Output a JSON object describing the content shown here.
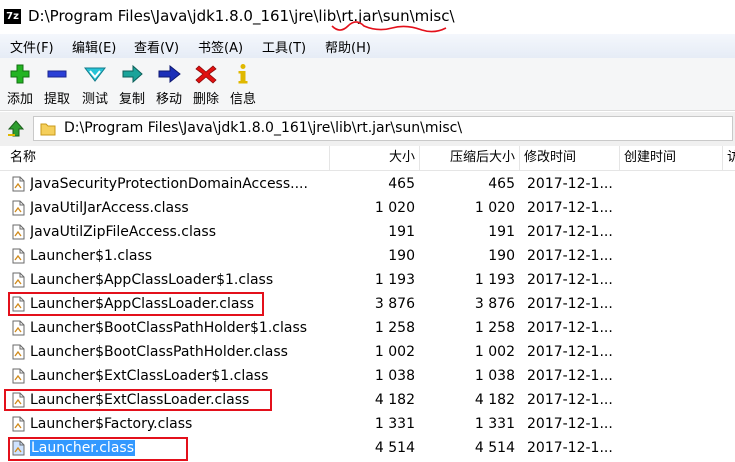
{
  "window": {
    "app_icon_label": "7z",
    "title": "D:\\Program Files\\Java\\jdk1.8.0_161\\jre\\lib\\rt.jar\\sun\\misc\\"
  },
  "menu": [
    "文件(F)",
    "编辑(E)",
    "查看(V)",
    "书签(A)",
    "工具(T)",
    "帮助(H)"
  ],
  "toolbar": {
    "add": "添加",
    "extract": "提取",
    "test": "测试",
    "copy": "复制",
    "move": "移动",
    "delete": "删除",
    "info": "信息"
  },
  "address": {
    "path": "D:\\Program Files\\Java\\jdk1.8.0_161\\jre\\lib\\rt.jar\\sun\\misc\\"
  },
  "columns": {
    "name": "名称",
    "size": "大小",
    "packed": "压缩后大小",
    "modified": "修改时间",
    "created": "创建时间",
    "extra": "访"
  },
  "files": [
    {
      "name": "JavaSecurityProtectionDomainAccess....",
      "size": "465",
      "packed": "465",
      "modified": "2017-12-1..."
    },
    {
      "name": "JavaUtilJarAccess.class",
      "size": "1 020",
      "packed": "1 020",
      "modified": "2017-12-1..."
    },
    {
      "name": "JavaUtilZipFileAccess.class",
      "size": "191",
      "packed": "191",
      "modified": "2017-12-1..."
    },
    {
      "name": "Launcher$1.class",
      "size": "190",
      "packed": "190",
      "modified": "2017-12-1..."
    },
    {
      "name": "Launcher$AppClassLoader$1.class",
      "size": "1 193",
      "packed": "1 193",
      "modified": "2017-12-1..."
    },
    {
      "name": "Launcher$AppClassLoader.class",
      "size": "3 876",
      "packed": "3 876",
      "modified": "2017-12-1..."
    },
    {
      "name": "Launcher$BootClassPathHolder$1.class",
      "size": "1 258",
      "packed": "1 258",
      "modified": "2017-12-1..."
    },
    {
      "name": "Launcher$BootClassPathHolder.class",
      "size": "1 002",
      "packed": "1 002",
      "modified": "2017-12-1..."
    },
    {
      "name": "Launcher$ExtClassLoader$1.class",
      "size": "1 038",
      "packed": "1 038",
      "modified": "2017-12-1..."
    },
    {
      "name": "Launcher$ExtClassLoader.class",
      "size": "4 182",
      "packed": "4 182",
      "modified": "2017-12-1..."
    },
    {
      "name": "Launcher$Factory.class",
      "size": "1 331",
      "packed": "1 331",
      "modified": "2017-12-1..."
    },
    {
      "name": "Launcher.class",
      "size": "4 514",
      "packed": "4 514",
      "modified": "2017-12-1..."
    }
  ],
  "selected_file": "Launcher.class",
  "colors": {
    "selection": "#3399ff",
    "annotation": "#e3101b"
  }
}
